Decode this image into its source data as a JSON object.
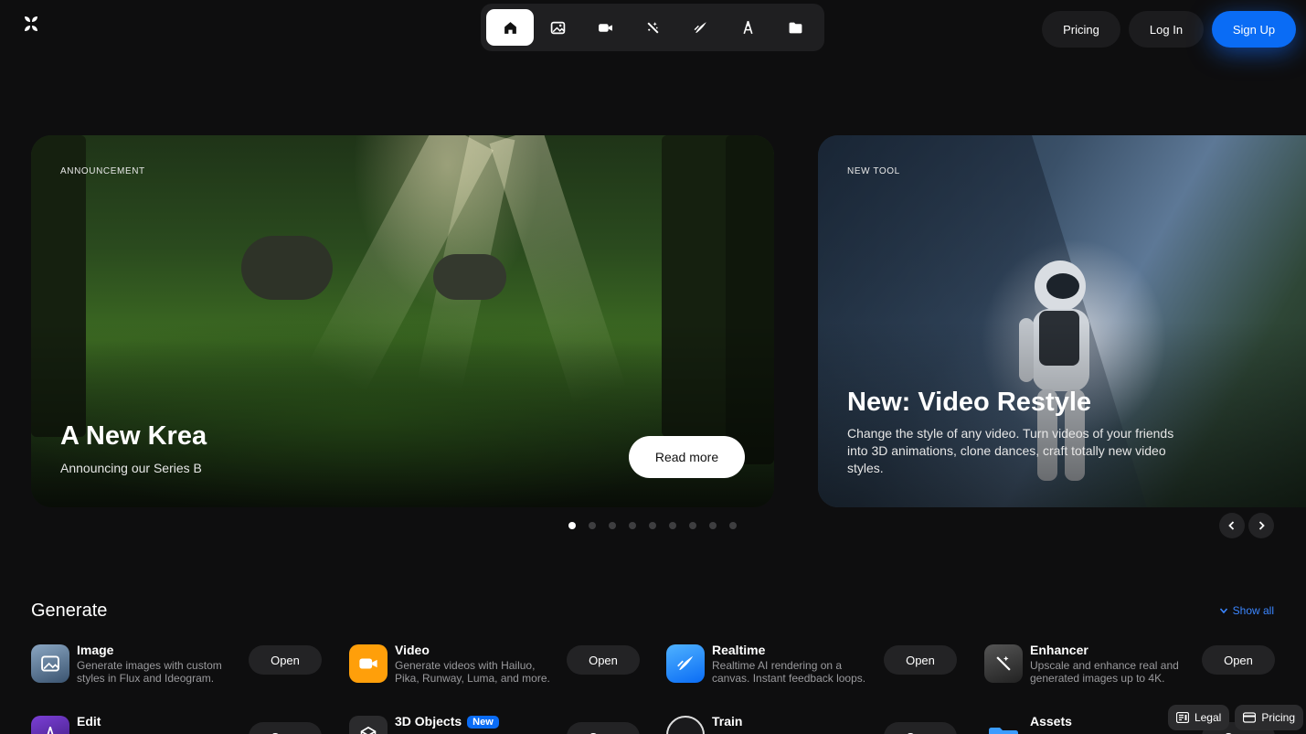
{
  "nav": {
    "items": [
      {
        "icon": "home-icon",
        "label": "Home"
      },
      {
        "icon": "image-icon",
        "label": "Image"
      },
      {
        "icon": "video-icon",
        "label": "Video"
      },
      {
        "icon": "enhancer-icon",
        "label": "Enhancer"
      },
      {
        "icon": "realtime-icon",
        "label": "Realtime"
      },
      {
        "icon": "edit-icon",
        "label": "Edit"
      },
      {
        "icon": "folder-icon",
        "label": "Assets"
      }
    ],
    "active": 0
  },
  "header": {
    "pricing_label": "Pricing",
    "login_label": "Log In",
    "signup_label": "Sign Up"
  },
  "carousel": {
    "slides": [
      {
        "eyebrow": "ANNOUNCEMENT",
        "title": "A New Krea",
        "subtitle": "Announcing our Series B",
        "button_label": "Read more"
      },
      {
        "eyebrow": "NEW TOOL",
        "title": "New: Video Restyle",
        "subtitle": "Change the style of any video. Turn videos of your friends into 3D animations, clone dances, craft totally new video styles."
      }
    ],
    "dot_count": 9,
    "active_dot": 0
  },
  "generate": {
    "title": "Generate",
    "show_all_label": "Show all",
    "open_label": "Open",
    "tools": [
      {
        "name": "Image",
        "desc": "Generate images with custom styles in Flux and Ideogram.",
        "icon": "image-tool-icon"
      },
      {
        "name": "Video",
        "desc": "Generate videos with Hailuo, Pika, Runway, Luma, and more.",
        "icon": "video-tool-icon"
      },
      {
        "name": "Realtime",
        "desc": "Realtime AI rendering on a canvas. Instant feedback loops.",
        "icon": "realtime-tool-icon"
      },
      {
        "name": "Enhancer",
        "desc": "Upscale and enhance real and generated images up to 4K.",
        "icon": "enhancer-tool-icon"
      },
      {
        "name": "Edit",
        "desc": "",
        "icon": "edit-tool-icon"
      },
      {
        "name": "3D Objects",
        "desc": "",
        "icon": "3d-objects-tool-icon",
        "badge": "New"
      },
      {
        "name": "Train",
        "desc": "",
        "icon": "train-tool-icon"
      },
      {
        "name": "Assets",
        "desc": "",
        "icon": "assets-tool-icon"
      }
    ]
  },
  "footer_buttons": {
    "legal_label": "Legal",
    "pricing_label": "Pricing"
  },
  "colors": {
    "background": "#0e0e0f",
    "accent": "#0a6cf5",
    "video_icon": "#ff9f0a",
    "realtime_icon": "#1a8cff"
  }
}
